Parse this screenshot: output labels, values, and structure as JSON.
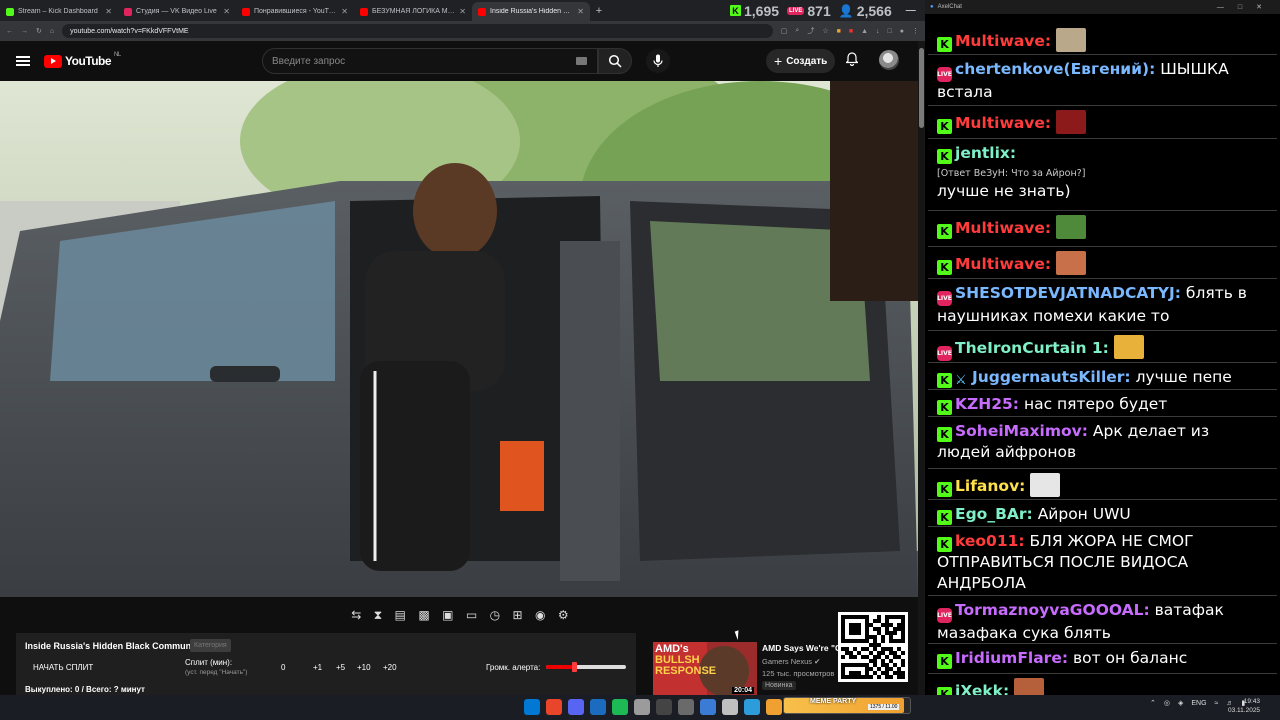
{
  "browser": {
    "tabs": [
      {
        "title": "Stream – Kick Dashboard",
        "color": "#53fc18",
        "active": false
      },
      {
        "title": "Студия — VK Видео Live",
        "color": "#e0245e",
        "active": false
      },
      {
        "title": "Понравившиеся - YouTube",
        "color": "#ff0000",
        "active": false
      },
      {
        "title": "БЕЗУМНАЯ ЛОГИКА МИРА КАРОЧЕ",
        "color": "#ff0000",
        "active": false
      },
      {
        "title": "Inside Russia's Hidden Black",
        "color": "#ff0000",
        "active": true
      }
    ],
    "url": "youtube.com/watch?v=FKkdVFFVtME",
    "counters": {
      "kick": "1,695",
      "vk_badge": "LIVE",
      "vk": "871",
      "viewers": "2,566"
    }
  },
  "youtube": {
    "region": "NL",
    "logo_text": "YouTube",
    "search_placeholder": "Введите запрос",
    "create_label": "Создать",
    "stream_panel": {
      "title": "Inside Russia's Hidden Black Community",
      "badge": "Категория",
      "start_split": "НАЧАТЬ СПЛИТ",
      "split_label": "Сплит (мин):",
      "split_hint": "(уст. перед \"Начать\")",
      "split_values": [
        "0",
        "+1",
        "+5",
        "+10",
        "+20"
      ],
      "alert_label": "Громк. алерта:",
      "alert_volume": 0.35,
      "bought": "Выкуплено: 0 / Всего: ? минут"
    },
    "recommended": {
      "title": "AMD Says We're \"Co",
      "channel": "Gamers Nexus",
      "views": "125 тыс. просмотров",
      "badge": "Новинка",
      "duration": "20:04",
      "thumb_text_1": "AMD's",
      "thumb_text_2": "BULLSH",
      "thumb_text_3": "RESPONSE"
    }
  },
  "chat": {
    "title": "AxelChat",
    "messages": [
      {
        "platform": "kick",
        "user": "Multiwave:",
        "color": "#ff3b3b",
        "text": "",
        "emote": "#b9a88a"
      },
      {
        "platform": "vk",
        "user": "chertenkove(Евгений):",
        "color": "#7ab8ff",
        "text": "ШЫШКА встала"
      },
      {
        "platform": "kick",
        "user": "Multiwave:",
        "color": "#ff3b3b",
        "text": "",
        "emote": "#8c1a1a"
      },
      {
        "platform": "kick",
        "user": "jentlix:",
        "color": "#7ff0c8",
        "reply": "[Ответ ВеЗуН: Что за Айрон?]",
        "text": "лучше не знать)"
      },
      {
        "platform": "kick",
        "user": "Multiwave:",
        "color": "#ff3b3b",
        "text": "",
        "emote": "#4f8a3a"
      },
      {
        "platform": "kick",
        "user": "Multiwave:",
        "color": "#ff3b3b",
        "text": "",
        "emote": "#c8704a"
      },
      {
        "platform": "vk",
        "user": "SHESOTDEVJATNADCATYJ:",
        "color": "#7ab8ff",
        "text": "блять в наушниках помехи какие то"
      },
      {
        "platform": "vk",
        "user": "TheIronCurtain 1:",
        "color": "#7ff0c8",
        "text": "",
        "emote": "#e8b23a"
      },
      {
        "platform": "kick",
        "user": "JuggernautsKiller:",
        "color": "#7ab8ff",
        "text": "лучше пепе",
        "sword": true
      },
      {
        "platform": "kick",
        "user": "KZH25:",
        "color": "#c86bff",
        "text": "нас пятеро будет"
      },
      {
        "platform": "kick",
        "user": "SoheiMaximov:",
        "color": "#c86bff",
        "text": "Арк делает из людей айфронов"
      },
      {
        "platform": "kick",
        "user": "Lifanov:",
        "color": "#ffe14a",
        "text": "",
        "emote": "#e6e6e6"
      },
      {
        "platform": "kick",
        "user": "Ego_BAr:",
        "color": "#7ff0c8",
        "text": "Айрон UWU"
      },
      {
        "platform": "kick",
        "user": "keo011:",
        "color": "#ff3b3b",
        "text": "БЛЯ ЖОРА НЕ СМОГ ОТПРАВИТЬСЯ ПОСЛЕ ВИДОСА АНДРБОЛА"
      },
      {
        "platform": "vk",
        "user": "TormaznoyvaGOOOAL:",
        "color": "#c86bff",
        "text": "ватафак мазафака сука блять"
      },
      {
        "platform": "kick",
        "user": "IridiumFlare:",
        "color": "#c86bff",
        "text": "вот он баланс"
      },
      {
        "platform": "kick",
        "user": "iXekk:",
        "color": "#7ff0c8",
        "text": "",
        "emote": "#b5603a"
      }
    ]
  },
  "taskbar": {
    "meme_title": "MEME PARTY",
    "meme_progress": "1375 / 11.00",
    "lang": "ENG",
    "time": "19:43",
    "date": "03.11.2025"
  }
}
